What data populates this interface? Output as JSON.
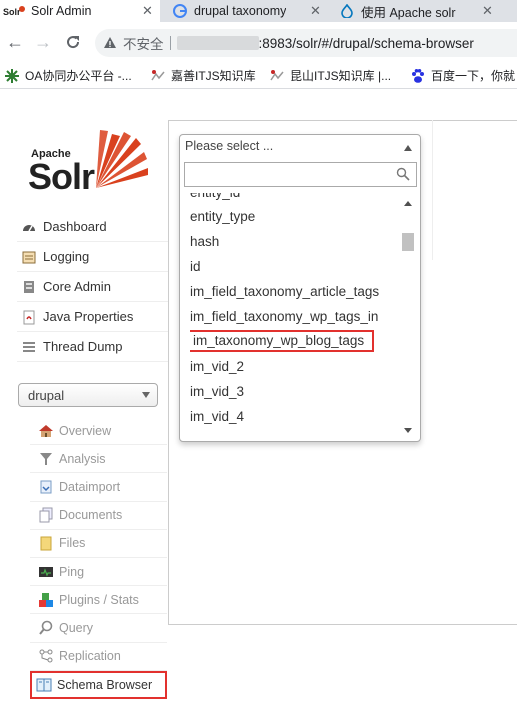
{
  "tabs": [
    {
      "title": "Solr Admin",
      "icon": "solr-favicon",
      "active": true
    },
    {
      "title": "drupal taxonomy",
      "icon": "google-icon",
      "active": false
    },
    {
      "title": "使用 Apache solr",
      "icon": "drupal-icon",
      "active": false
    }
  ],
  "toolbar": {
    "back": "←",
    "forward": "→",
    "reload": "C",
    "security_label": "不安全",
    "url": ":8983/solr/#/drupal/schema-browser"
  },
  "bookmarks": [
    {
      "label": "OA协同办公平台 -...",
      "icon": "oa-icon"
    },
    {
      "label": "嘉善ITJS知识库",
      "icon": "itjs-icon"
    },
    {
      "label": "昆山ITJS知识库 |...",
      "icon": "itjs-icon"
    },
    {
      "label": "百度一下，你就",
      "icon": "baidu-paw-icon"
    }
  ],
  "logo": {
    "apache": "Apache",
    "solr": "Solr"
  },
  "main_nav": [
    {
      "label": "Dashboard",
      "icon": "dashboard-icon"
    },
    {
      "label": "Logging",
      "icon": "logging-icon"
    },
    {
      "label": "Core Admin",
      "icon": "core-admin-icon"
    },
    {
      "label": "Java Properties",
      "icon": "java-icon"
    },
    {
      "label": "Thread Dump",
      "icon": "thread-dump-icon"
    }
  ],
  "core_selector": {
    "value": "drupal"
  },
  "core_nav": [
    {
      "label": "Overview",
      "icon": "home-icon"
    },
    {
      "label": "Analysis",
      "icon": "filter-icon"
    },
    {
      "label": "Dataimport",
      "icon": "dataimport-icon"
    },
    {
      "label": "Documents",
      "icon": "documents-icon"
    },
    {
      "label": "Files",
      "icon": "folder-icon"
    },
    {
      "label": "Ping",
      "icon": "ping-icon"
    },
    {
      "label": "Plugins / Stats",
      "icon": "plugins-icon"
    },
    {
      "label": "Query",
      "icon": "magnifier-icon"
    },
    {
      "label": "Replication",
      "icon": "replication-icon"
    },
    {
      "label": "Schema Browser",
      "icon": "book-icon",
      "selected": true
    }
  ],
  "field_select": {
    "placeholder": "Please select ...",
    "options": [
      {
        "label": "entity_id"
      },
      {
        "label": "entity_type"
      },
      {
        "label": "hash"
      },
      {
        "label": "id"
      },
      {
        "label": "im_field_taxonomy_article_tags"
      },
      {
        "label": "im_field_taxonomy_wp_tags_in"
      },
      {
        "label": "im_taxonomy_wp_blog_tags",
        "highlighted": true
      },
      {
        "label": "im_vid_2"
      },
      {
        "label": "im_vid_3"
      },
      {
        "label": "im_vid_4"
      }
    ]
  },
  "colors": {
    "highlight_border": "#e2312e",
    "solr_orange": "#d9411e"
  }
}
